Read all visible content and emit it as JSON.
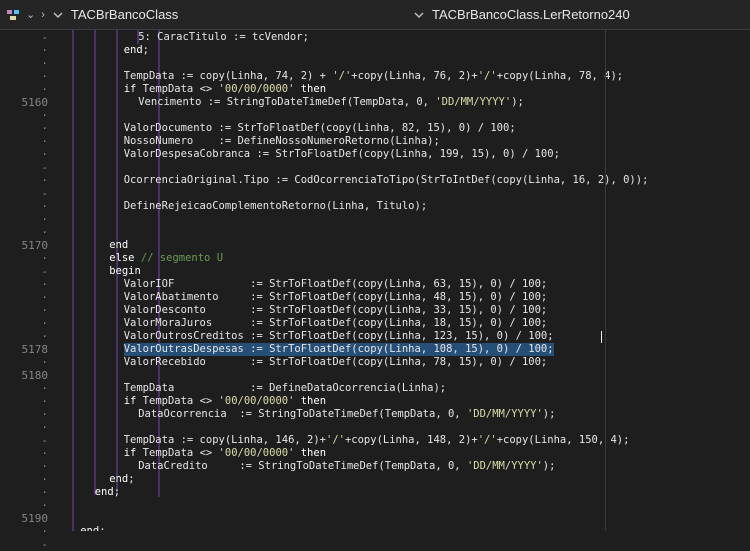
{
  "topbar": {
    "left_title": "TACBrBancoClass",
    "right_title": "TACBrBancoClass.LerRetorno240"
  },
  "gutter": {
    "items": [
      {
        "t": "-",
        "row": 1
      },
      {
        "t": "·",
        "row": 2
      },
      {
        "t": "·",
        "row": 3
      },
      {
        "t": "·",
        "row": 4
      },
      {
        "t": "·",
        "row": 5
      },
      {
        "t": "5160",
        "row": 6
      },
      {
        "t": "·",
        "row": 7
      },
      {
        "t": "·",
        "row": 8
      },
      {
        "t": "·",
        "row": 9
      },
      {
        "t": "·",
        "row": 10
      },
      {
        "t": "-",
        "row": 11
      },
      {
        "t": "·",
        "row": 12
      },
      {
        "t": "-",
        "row": 13
      },
      {
        "t": "·",
        "row": 14
      },
      {
        "t": "·",
        "row": 15
      },
      {
        "t": "·",
        "row": 16
      },
      {
        "t": "5170",
        "row": 17
      },
      {
        "t": "·",
        "row": 18
      },
      {
        "t": "-",
        "row": 19
      },
      {
        "t": "·",
        "row": 20
      },
      {
        "t": "·",
        "row": 21
      },
      {
        "t": "·",
        "row": 22
      },
      {
        "t": "·",
        "row": 23
      },
      {
        "t": "·",
        "row": 24
      },
      {
        "t": "5178",
        "row": 25
      },
      {
        "t": "·",
        "row": 26
      },
      {
        "t": "5180",
        "row": 27
      },
      {
        "t": "·",
        "row": 28
      },
      {
        "t": "·",
        "row": 29
      },
      {
        "t": "·",
        "row": 30
      },
      {
        "t": "·",
        "row": 31
      },
      {
        "t": "-",
        "row": 32
      },
      {
        "t": "·",
        "row": 33
      },
      {
        "t": "·",
        "row": 34
      },
      {
        "t": "·",
        "row": 35
      },
      {
        "t": "·",
        "row": 36
      },
      {
        "t": "·",
        "row": 37
      },
      {
        "t": "5190",
        "row": 38
      },
      {
        "t": "·",
        "row": 39
      },
      {
        "t": "-",
        "row": 40
      }
    ]
  },
  "code": {
    "lines": [
      {
        "row": 1,
        "indent": 9,
        "segments": [
          {
            "k": "n",
            "t": "5: CaracTitulo := tcVendor;"
          }
        ]
      },
      {
        "row": 2,
        "indent": 7,
        "segments": [
          {
            "k": "kw",
            "t": "end"
          },
          {
            "k": "n",
            "t": ";"
          }
        ]
      },
      {
        "row": 3,
        "indent": 0,
        "segments": [
          {
            "k": "n",
            "t": ""
          }
        ]
      },
      {
        "row": 4,
        "indent": 7,
        "segments": [
          {
            "k": "n",
            "t": "TempData := copy(Linha, 74, 2) + "
          },
          {
            "k": "str",
            "t": "'/'"
          },
          {
            "k": "n",
            "t": "+copy(Linha, 76, 2)+"
          },
          {
            "k": "str",
            "t": "'/'"
          },
          {
            "k": "n",
            "t": "+copy(Linha, 78, 4);"
          }
        ]
      },
      {
        "row": 5,
        "indent": 7,
        "segments": [
          {
            "k": "kw",
            "t": "if"
          },
          {
            "k": "n",
            "t": " TempData <> "
          },
          {
            "k": "str",
            "t": "'00/00/0000'"
          },
          {
            "k": "n",
            "t": " "
          },
          {
            "k": "kw",
            "t": "then"
          }
        ]
      },
      {
        "row": 6,
        "indent": 9,
        "segments": [
          {
            "k": "n",
            "t": "Vencimento := StringToDateTimeDef(TempData, 0, "
          },
          {
            "k": "str",
            "t": "'DD/MM/YYYY'"
          },
          {
            "k": "n",
            "t": ");"
          }
        ]
      },
      {
        "row": 7,
        "indent": 0,
        "segments": [
          {
            "k": "n",
            "t": ""
          }
        ]
      },
      {
        "row": 8,
        "indent": 7,
        "segments": [
          {
            "k": "n",
            "t": "ValorDocumento := StrToFloatDef(copy(Linha, 82, 15), 0) / 100;"
          }
        ]
      },
      {
        "row": 9,
        "indent": 7,
        "segments": [
          {
            "k": "n",
            "t": "NossoNumero    := DefineNossoNumeroRetorno(Linha);"
          }
        ]
      },
      {
        "row": 10,
        "indent": 7,
        "segments": [
          {
            "k": "n",
            "t": "ValorDespesaCobranca := StrToFloatDef(copy(Linha, 199, 15), 0) / 100;"
          }
        ]
      },
      {
        "row": 11,
        "indent": 0,
        "segments": [
          {
            "k": "n",
            "t": ""
          }
        ]
      },
      {
        "row": 12,
        "indent": 7,
        "segments": [
          {
            "k": "n",
            "t": "OcorrenciaOriginal.Tipo := CodOcorrenciaToTipo(StrToIntDef(copy(Linha, 16, 2), 0));"
          }
        ]
      },
      {
        "row": 13,
        "indent": 0,
        "segments": [
          {
            "k": "n",
            "t": ""
          }
        ]
      },
      {
        "row": 14,
        "indent": 7,
        "segments": [
          {
            "k": "n",
            "t": "DefineRejeicaoComplementoRetorno(Linha, Titulo);"
          }
        ]
      },
      {
        "row": 15,
        "indent": 0,
        "segments": [
          {
            "k": "n",
            "t": ""
          }
        ]
      },
      {
        "row": 16,
        "indent": 0,
        "segments": [
          {
            "k": "n",
            "t": ""
          }
        ]
      },
      {
        "row": 17,
        "indent": 5,
        "segments": [
          {
            "k": "kw",
            "t": "end"
          }
        ]
      },
      {
        "row": 18,
        "indent": 5,
        "segments": [
          {
            "k": "kw",
            "t": "else"
          },
          {
            "k": "n",
            "t": " "
          },
          {
            "k": "cm",
            "t": "// segmento U"
          }
        ]
      },
      {
        "row": 19,
        "indent": 5,
        "segments": [
          {
            "k": "kw",
            "t": "begin"
          }
        ]
      },
      {
        "row": 20,
        "indent": 7,
        "segments": [
          {
            "k": "n",
            "t": "ValorIOF            := StrToFloatDef(copy(Linha, 63, 15), 0) / 100;"
          }
        ]
      },
      {
        "row": 21,
        "indent": 7,
        "segments": [
          {
            "k": "n",
            "t": "ValorAbatimento     := StrToFloatDef(copy(Linha, 48, 15), 0) / 100;"
          }
        ]
      },
      {
        "row": 22,
        "indent": 7,
        "segments": [
          {
            "k": "n",
            "t": "ValorDesconto       := StrToFloatDef(copy(Linha, 33, 15), 0) / 100;"
          }
        ]
      },
      {
        "row": 23,
        "indent": 7,
        "segments": [
          {
            "k": "n",
            "t": "ValorMoraJuros      := StrToFloatDef(copy(Linha, 18, 15), 0) / 100;"
          }
        ]
      },
      {
        "row": 24,
        "indent": 7,
        "segments": [
          {
            "k": "n",
            "t": "ValorOutrosCreditos := StrToFloatDef(copy(Linha, 123, 15), 0) / 100;"
          }
        ]
      },
      {
        "row": 25,
        "indent": 7,
        "selected": true,
        "segments": [
          {
            "k": "n",
            "t": "ValorOutrasDespesas := StrToFloatDef(copy(Linha, 108, 15), 0) / 100;"
          }
        ]
      },
      {
        "row": 26,
        "indent": 7,
        "segments": [
          {
            "k": "n",
            "t": "ValorRecebido       := StrToFloatDef(copy(Linha, 78, 15), 0) / 100;"
          }
        ]
      },
      {
        "row": 27,
        "indent": 0,
        "segments": [
          {
            "k": "n",
            "t": ""
          }
        ]
      },
      {
        "row": 28,
        "indent": 7,
        "segments": [
          {
            "k": "n",
            "t": "TempData            := DefineDataOcorrencia(Linha);"
          }
        ]
      },
      {
        "row": 29,
        "indent": 7,
        "segments": [
          {
            "k": "kw",
            "t": "if"
          },
          {
            "k": "n",
            "t": " TempData <> "
          },
          {
            "k": "str",
            "t": "'00/00/0000'"
          },
          {
            "k": "n",
            "t": " "
          },
          {
            "k": "kw",
            "t": "then"
          }
        ]
      },
      {
        "row": 30,
        "indent": 9,
        "segments": [
          {
            "k": "n",
            "t": "DataOcorrencia  := StringToDateTimeDef(TempData, 0, "
          },
          {
            "k": "str",
            "t": "'DD/MM/YYYY'"
          },
          {
            "k": "n",
            "t": ");"
          }
        ]
      },
      {
        "row": 31,
        "indent": 0,
        "segments": [
          {
            "k": "n",
            "t": ""
          }
        ]
      },
      {
        "row": 32,
        "indent": 7,
        "segments": [
          {
            "k": "n",
            "t": "TempData := copy(Linha, 146, 2)+"
          },
          {
            "k": "str",
            "t": "'/'"
          },
          {
            "k": "n",
            "t": "+copy(Linha, 148, 2)+"
          },
          {
            "k": "str",
            "t": "'/'"
          },
          {
            "k": "n",
            "t": "+copy(Linha, 150, 4);"
          }
        ]
      },
      {
        "row": 33,
        "indent": 7,
        "segments": [
          {
            "k": "kw",
            "t": "if"
          },
          {
            "k": "n",
            "t": " TempData <> "
          },
          {
            "k": "str",
            "t": "'00/00/0000'"
          },
          {
            "k": "n",
            "t": " "
          },
          {
            "k": "kw",
            "t": "then"
          }
        ]
      },
      {
        "row": 34,
        "indent": 9,
        "segments": [
          {
            "k": "n",
            "t": "DataCredito     := StringToDateTimeDef(TempData, 0, "
          },
          {
            "k": "str",
            "t": "'DD/MM/YYYY'"
          },
          {
            "k": "n",
            "t": ");"
          }
        ]
      },
      {
        "row": 35,
        "indent": 5,
        "segments": [
          {
            "k": "kw",
            "t": "end"
          },
          {
            "k": "n",
            "t": ";"
          }
        ]
      },
      {
        "row": 36,
        "indent": 3,
        "segments": [
          {
            "k": "kw",
            "t": "end"
          },
          {
            "k": "n",
            "t": ";"
          }
        ]
      },
      {
        "row": 37,
        "indent": 0,
        "segments": [
          {
            "k": "n",
            "t": ""
          }
        ]
      },
      {
        "row": 38,
        "indent": 0,
        "segments": [
          {
            "k": "n",
            "t": ""
          }
        ]
      },
      {
        "row": 39,
        "indent": 1,
        "segments": [
          {
            "k": "kw",
            "t": "end"
          },
          {
            "k": "n",
            "t": ";"
          }
        ]
      },
      {
        "row": 40,
        "indent": 0,
        "segments": [
          {
            "k": "n",
            "t": ""
          }
        ]
      }
    ]
  }
}
